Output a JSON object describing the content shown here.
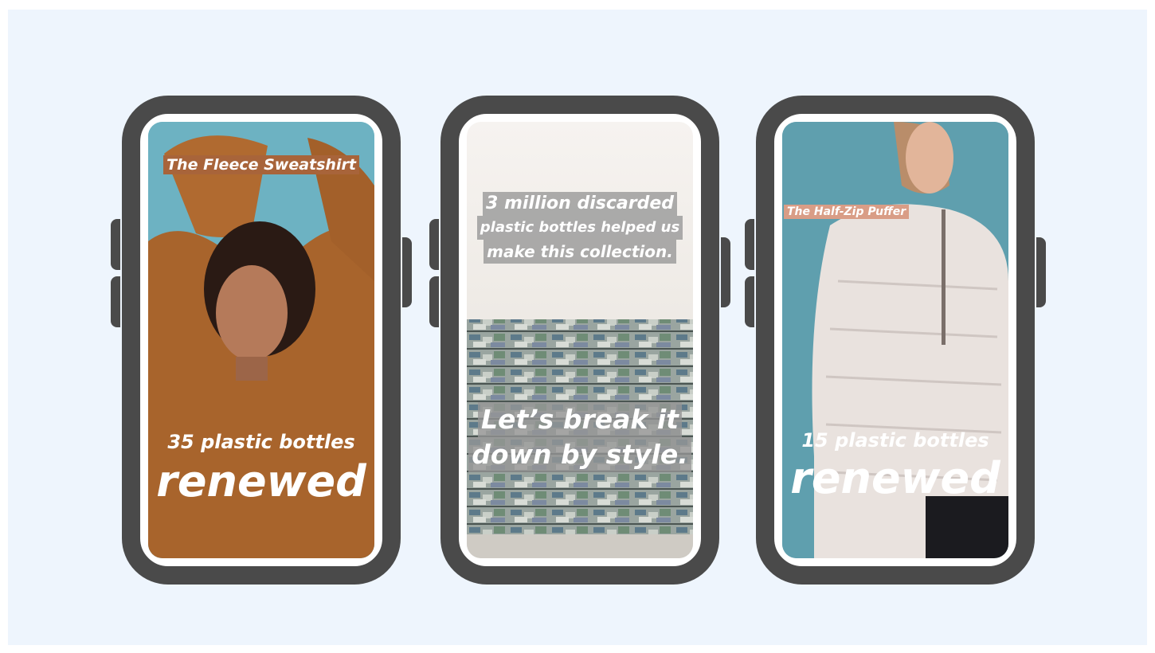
{
  "phones": [
    {
      "caption_top": "The Fleece Sweatshirt",
      "caption_mid": "35 plastic bottles",
      "caption_big": "renewed"
    },
    {
      "caption_lines": [
        "3 million discarded",
        "plastic bottles helped us",
        "make this collection."
      ],
      "caption_big_lines": [
        "Let’s break it",
        "down by style."
      ]
    },
    {
      "caption_top": "The Half-Zip Puffer",
      "caption_mid": "15 plastic bottles",
      "caption_big": "renewed"
    }
  ]
}
